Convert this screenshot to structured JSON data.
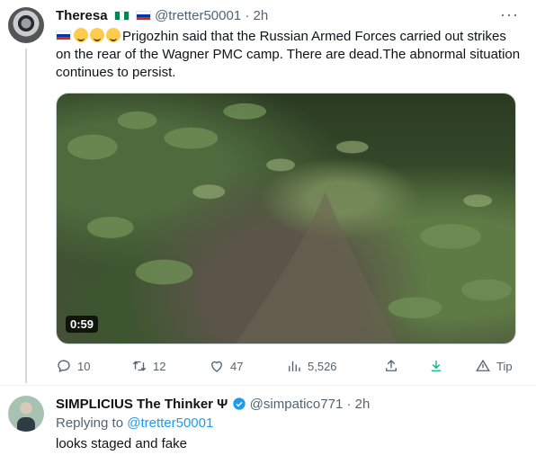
{
  "tweet": {
    "author_name": "Theresa",
    "handle": "@tretter50001",
    "separator": "·",
    "time": "2h",
    "more_label": "···",
    "text": "Prigozhin said that the Russian Armed Forces carried out strikes on the rear of the Wagner PMC camp. There are dead.The abnormal situation continues to persist.",
    "media": {
      "duration": "0:59"
    },
    "actions": {
      "reply_count": "10",
      "retweet_count": "12",
      "like_count": "47",
      "views_count": "5,526",
      "tip_label": "Tip"
    }
  },
  "reply": {
    "author_name": "SIMPLICIUS The Thinker Ψ",
    "handle": "@simpatico771",
    "separator": "·",
    "time": "2h",
    "replying_prefix": "Replying to",
    "replying_handle": "@tretter50001",
    "text": "looks staged and fake"
  },
  "colors": {
    "accent": "#1d9bf0",
    "muted": "#536471",
    "text": "#0f1419",
    "share_green": "#00ba7c"
  }
}
